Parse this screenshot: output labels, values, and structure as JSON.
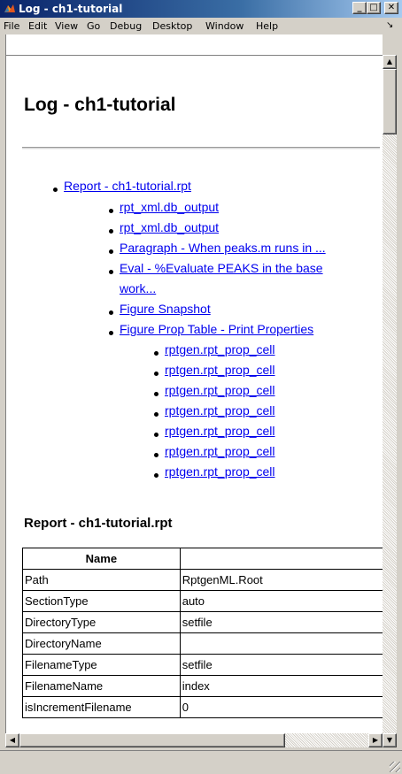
{
  "window": {
    "title": "Log - ch1-tutorial",
    "controls": {
      "minimize": "_",
      "maximize": "□",
      "close": "✕"
    }
  },
  "menu": [
    "File",
    "Edit",
    "View",
    "Go",
    "Debug",
    "Desktop",
    "Window",
    "Help"
  ],
  "page": {
    "title": "Log - ch1-tutorial",
    "toc": {
      "root": "Report - ch1-tutorial.rpt",
      "level1": [
        "rpt_xml.db_output",
        "rpt_xml.db_output",
        "Paragraph - When peaks.m runs in ...",
        "Eval - %Evaluate PEAKS in the base",
        "work...",
        "Figure Snapshot",
        "Figure Prop Table - Print Properties"
      ],
      "level2": [
        "rptgen.rpt_prop_cell",
        "rptgen.rpt_prop_cell",
        "rptgen.rpt_prop_cell",
        "rptgen.rpt_prop_cell",
        "rptgen.rpt_prop_cell",
        "rptgen.rpt_prop_cell",
        "rptgen.rpt_prop_cell"
      ]
    },
    "section_heading": "Report - ch1-tutorial.rpt",
    "table": {
      "header": [
        "Name",
        ""
      ],
      "rows": [
        [
          "Path",
          "RptgenML.Root"
        ],
        [
          "SectionType",
          "auto"
        ],
        [
          "DirectoryType",
          "setfile"
        ],
        [
          "DirectoryName",
          ""
        ],
        [
          "FilenameType",
          "setfile"
        ],
        [
          "FilenameName",
          "index"
        ],
        [
          "isIncrementFilename",
          "0"
        ]
      ]
    }
  }
}
